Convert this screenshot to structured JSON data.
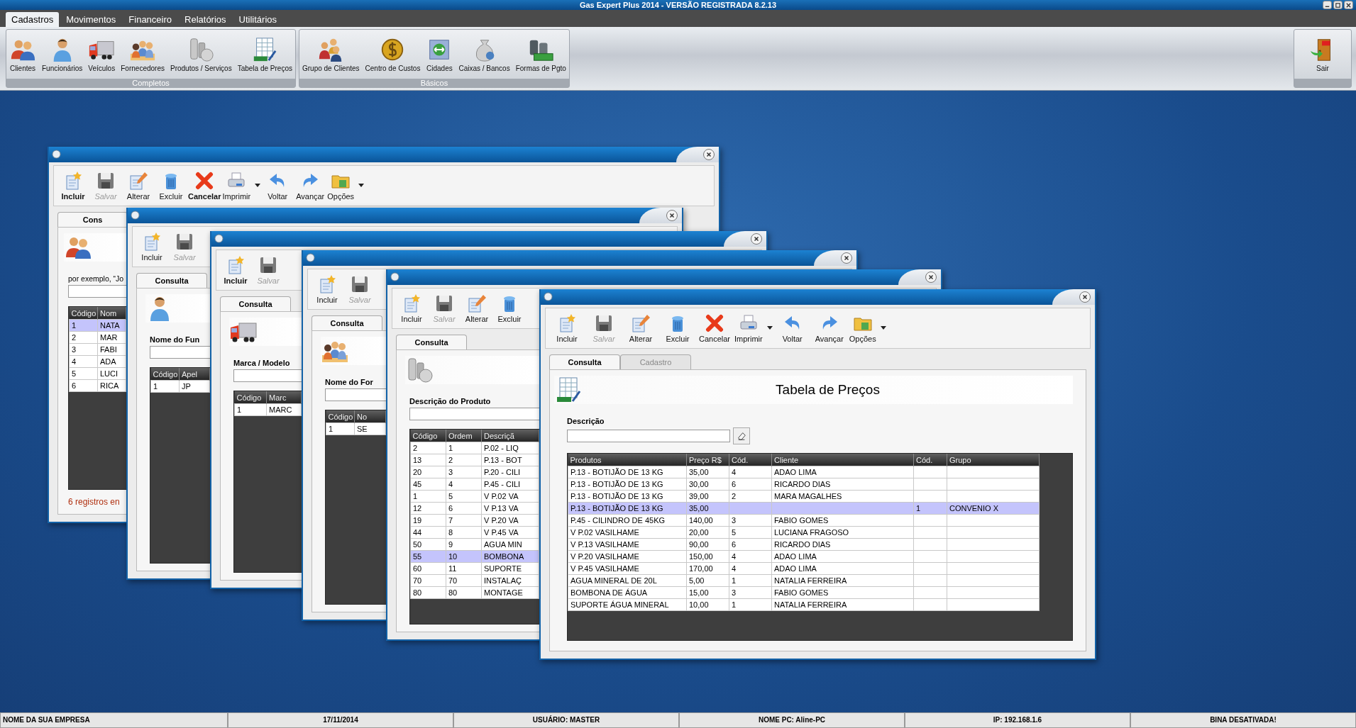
{
  "app_title": "Gas Expert Plus 2014 - VERSÃO REGISTRADA 8.2.13",
  "menu_tabs": [
    {
      "label": "Cadastros",
      "selected": true
    },
    {
      "label": "Movimentos",
      "selected": false
    },
    {
      "label": "Financeiro",
      "selected": false
    },
    {
      "label": "Relatórios",
      "selected": false
    },
    {
      "label": "Utilitários",
      "selected": false
    }
  ],
  "ribbon_groups": [
    {
      "caption": "Completos",
      "items": [
        {
          "label": "Clientes",
          "kind": "clients"
        },
        {
          "label": "Funcionários",
          "kind": "employee"
        },
        {
          "label": "Veículos",
          "kind": "vehicle"
        },
        {
          "label": "Fornecedores",
          "kind": "suppliers"
        },
        {
          "label": "Produtos / Serviços",
          "kind": "products"
        },
        {
          "label": "Tabela de Preços",
          "kind": "pricetable"
        }
      ]
    },
    {
      "caption": "Básicos",
      "items": [
        {
          "label": "Grupo de Clientes",
          "kind": "clientgroup"
        },
        {
          "label": "Centro de Custos",
          "kind": "costcenter"
        },
        {
          "label": "Cidades",
          "kind": "cities"
        },
        {
          "label": "Caixas / Bancos",
          "kind": "cashboxes"
        },
        {
          "label": "Formas de Pgto",
          "kind": "payment"
        }
      ]
    }
  ],
  "exit_button": {
    "label": "Sair",
    "kind": "exit"
  },
  "windows": [
    {
      "toolbar": [
        {
          "label": "Incluir",
          "kind": "new",
          "bold": true,
          "disabled": false,
          "dropdown": false
        },
        {
          "label": "Salvar",
          "kind": "save",
          "bold": false,
          "disabled": true,
          "dropdown": false
        },
        {
          "label": "Alterar",
          "kind": "edit",
          "bold": false,
          "disabled": false,
          "dropdown": false
        },
        {
          "label": "Excluir",
          "kind": "delete",
          "bold": false,
          "disabled": false,
          "dropdown": false
        },
        {
          "label": "Cancelar",
          "kind": "cancel",
          "bold": true,
          "disabled": false,
          "dropdown": false
        },
        {
          "label": "Imprimir",
          "kind": "print",
          "bold": false,
          "disabled": false,
          "dropdown": true
        },
        {
          "label": "Voltar",
          "kind": "back",
          "bold": false,
          "disabled": false,
          "dropdown": false
        },
        {
          "label": "Avançar",
          "kind": "forward",
          "bold": false,
          "disabled": false,
          "dropdown": false
        },
        {
          "label": "Opções",
          "kind": "options",
          "bold": false,
          "disabled": false,
          "dropdown": true
        }
      ],
      "tabs": [
        {
          "label": "Cons",
          "selected": true
        }
      ],
      "kind": "clients",
      "filter_label": "por exemplo, “Jo",
      "grid": {
        "columns": [
          "Código",
          "Nom"
        ],
        "rows": [
          {
            "cells": [
              "1",
              "NATA"
            ],
            "selected": true
          },
          {
            "cells": [
              "2",
              "MAR"
            ],
            "selected": false
          },
          {
            "cells": [
              "3",
              "FABI"
            ],
            "selected": false
          },
          {
            "cells": [
              "4",
              "ADA"
            ],
            "selected": false
          },
          {
            "cells": [
              "5",
              "LUCI"
            ],
            "selected": false
          },
          {
            "cells": [
              "6",
              "RICA"
            ],
            "selected": false
          }
        ]
      },
      "footer": "6 registros en"
    },
    {
      "toolbar": [
        {
          "label": "Incluir",
          "kind": "new",
          "bold": false,
          "disabled": false,
          "dropdown": false
        },
        {
          "label": "Salvar",
          "kind": "save",
          "bold": false,
          "disabled": true,
          "dropdown": false
        }
      ],
      "tabs": [
        {
          "label": "Consulta",
          "selected": true
        }
      ],
      "kind": "employee",
      "filter_label": "Nome do Fun",
      "grid": {
        "columns": [
          "Código",
          "Apel"
        ],
        "rows": [
          {
            "cells": [
              "1",
              "JP"
            ],
            "selected": false
          }
        ]
      }
    },
    {
      "toolbar": [
        {
          "label": "Incluir",
          "kind": "new",
          "bold": true,
          "disabled": false,
          "dropdown": false
        },
        {
          "label": "Salvar",
          "kind": "save",
          "bold": false,
          "disabled": true,
          "dropdown": false
        }
      ],
      "tabs": [
        {
          "label": "Consulta",
          "selected": true
        }
      ],
      "kind": "vehicle",
      "filter_label": "Marca / Modelo",
      "grid": {
        "columns": [
          "Código",
          "Marc"
        ],
        "rows": [
          {
            "cells": [
              "1",
              "MARC"
            ],
            "selected": false
          }
        ]
      }
    },
    {
      "toolbar": [
        {
          "label": "Incluir",
          "kind": "new",
          "bold": false,
          "disabled": false,
          "dropdown": false
        },
        {
          "label": "Salvar",
          "kind": "save",
          "bold": false,
          "disabled": true,
          "dropdown": false
        }
      ],
      "tabs": [
        {
          "label": "Consulta",
          "selected": true
        }
      ],
      "kind": "suppliers",
      "filter_label": "Nome do For",
      "grid": {
        "columns": [
          "Código",
          "No"
        ],
        "rows": [
          {
            "cells": [
              "1",
              "SE"
            ],
            "selected": false
          }
        ]
      }
    },
    {
      "toolbar": [
        {
          "label": "Incluir",
          "kind": "new",
          "bold": false,
          "disabled": false,
          "dropdown": false
        },
        {
          "label": "Salvar",
          "kind": "save",
          "bold": false,
          "disabled": true,
          "dropdown": false
        },
        {
          "label": "Alterar",
          "kind": "edit",
          "bold": false,
          "disabled": false,
          "dropdown": false
        },
        {
          "label": "Excluir",
          "kind": "delete",
          "bold": false,
          "disabled": false,
          "dropdown": false
        }
      ],
      "tabs": [
        {
          "label": "Consulta",
          "selected": true
        }
      ],
      "kind": "products",
      "filter_label": "Descrição do Produto",
      "grid": {
        "columns": [
          "Código",
          "Ordem",
          "Descriçã"
        ],
        "rows": [
          {
            "cells": [
              "2",
              "1",
              "P.02 - LIQ"
            ],
            "selected": false
          },
          {
            "cells": [
              "13",
              "2",
              "P.13 - BOT"
            ],
            "selected": false
          },
          {
            "cells": [
              "20",
              "3",
              "P.20 - CILI"
            ],
            "selected": false
          },
          {
            "cells": [
              "45",
              "4",
              "P.45 - CILI"
            ],
            "selected": false
          },
          {
            "cells": [
              "1",
              "5",
              "V P.02 VA"
            ],
            "selected": false
          },
          {
            "cells": [
              "12",
              "6",
              "V P.13 VA"
            ],
            "selected": false
          },
          {
            "cells": [
              "19",
              "7",
              "V P.20 VA"
            ],
            "selected": false
          },
          {
            "cells": [
              "44",
              "8",
              "V P.45 VA"
            ],
            "selected": false
          },
          {
            "cells": [
              "50",
              "9",
              "AGUA MIN"
            ],
            "selected": false
          },
          {
            "cells": [
              "55",
              "10",
              "BOMBONA"
            ],
            "selected": true
          },
          {
            "cells": [
              "60",
              "11",
              "SUPORTE"
            ],
            "selected": false
          },
          {
            "cells": [
              "70",
              "70",
              "INSTALAÇ"
            ],
            "selected": false
          },
          {
            "cells": [
              "80",
              "80",
              "MONTAGE"
            ],
            "selected": false
          }
        ]
      }
    },
    {
      "toolbar": [
        {
          "label": "Incluir",
          "kind": "new",
          "bold": false,
          "disabled": false,
          "dropdown": false
        },
        {
          "label": "Salvar",
          "kind": "save",
          "bold": false,
          "disabled": true,
          "dropdown": false
        },
        {
          "label": "Alterar",
          "kind": "edit",
          "bold": false,
          "disabled": false,
          "dropdown": false
        },
        {
          "label": "Excluir",
          "kind": "delete",
          "bold": false,
          "disabled": false,
          "dropdown": false
        },
        {
          "label": "Cancelar",
          "kind": "cancel",
          "bold": false,
          "disabled": false,
          "dropdown": false
        },
        {
          "label": "Imprimir",
          "kind": "print",
          "bold": false,
          "disabled": false,
          "dropdown": true
        },
        {
          "label": "Voltar",
          "kind": "back",
          "bold": false,
          "disabled": false,
          "dropdown": false
        },
        {
          "label": "Avançar",
          "kind": "forward",
          "bold": false,
          "disabled": false,
          "dropdown": false
        },
        {
          "label": "Opções",
          "kind": "options",
          "bold": false,
          "disabled": false,
          "dropdown": true
        }
      ],
      "tabs": [
        {
          "label": "Consulta",
          "selected": true
        },
        {
          "label": "Cadastro",
          "selected": false
        }
      ],
      "kind": "pricetable",
      "header_title": "Tabela de Preços",
      "filter_label": "Descrição",
      "clear_button": true,
      "grid": {
        "columns": [
          "Produtos",
          "Preço R$",
          "Cód.",
          "Cliente",
          "Cód.",
          "Grupo"
        ],
        "rows": [
          {
            "cells": [
              "P.13 - BOTIJÃO DE 13 KG",
              "35,00",
              "4",
              "ADAO LIMA",
              null,
              null
            ],
            "selected": false
          },
          {
            "cells": [
              "P.13 - BOTIJÃO DE 13 KG",
              "30,00",
              "6",
              "RICARDO DIAS",
              null,
              null
            ],
            "selected": false
          },
          {
            "cells": [
              "P.13 - BOTIJÃO DE 13 KG",
              "39,00",
              "2",
              "MARA MAGALHES",
              null,
              null
            ],
            "selected": false
          },
          {
            "cells": [
              "P.13 - BOTIJÃO DE 13 KG",
              "35,00",
              null,
              null,
              "1",
              "CONVENIO X"
            ],
            "selected": true
          },
          {
            "cells": [
              "P.45 - CILINDRO DE 45KG",
              "140,00",
              "3",
              "FABIO GOMES",
              null,
              null
            ],
            "selected": false
          },
          {
            "cells": [
              "V P.02 VASILHAME",
              "20,00",
              "5",
              "LUCIANA FRAGOSO",
              null,
              null
            ],
            "selected": false
          },
          {
            "cells": [
              "V P.13 VASILHAME",
              "90,00",
              "6",
              "RICARDO DIAS",
              null,
              null
            ],
            "selected": false
          },
          {
            "cells": [
              "V P.20 VASILHAME",
              "150,00",
              "4",
              "ADAO LIMA",
              null,
              null
            ],
            "selected": false
          },
          {
            "cells": [
              "V P.45 VASILHAME",
              "170,00",
              "4",
              "ADAO LIMA",
              null,
              null
            ],
            "selected": false
          },
          {
            "cells": [
              "AGUA MINERAL DE 20L",
              "5,00",
              "1",
              "NATALIA FERREIRA",
              null,
              null
            ],
            "selected": false
          },
          {
            "cells": [
              "BOMBONA DE ÁGUA",
              "15,00",
              "3",
              "FABIO GOMES",
              null,
              null
            ],
            "selected": false
          },
          {
            "cells": [
              "SUPORTE ÁGUA MINERAL",
              "10,00",
              "1",
              "NATALIA FERREIRA",
              null,
              null
            ],
            "selected": false
          }
        ]
      }
    }
  ],
  "status_bar": [
    "NOME DA SUA EMPRESA",
    "17/11/2014",
    "USUÁRIO: MASTER",
    "NOME PC: Aline-PC",
    "IP: 192.168.1.6",
    "BINA DESATIVADA!"
  ]
}
